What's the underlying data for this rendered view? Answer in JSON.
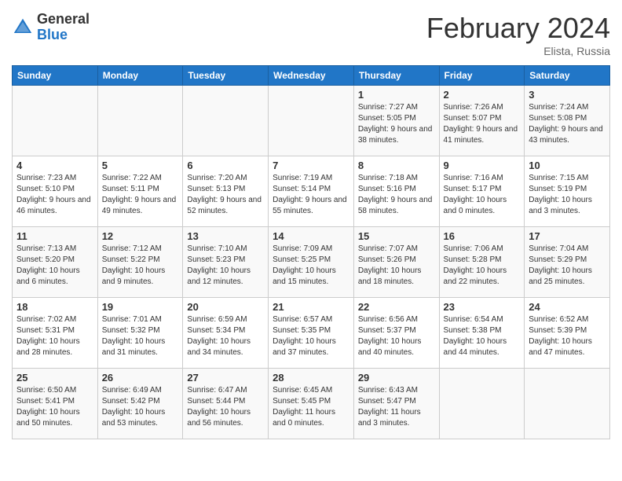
{
  "header": {
    "logo_general": "General",
    "logo_blue": "Blue",
    "month_title": "February 2024",
    "location": "Elista, Russia"
  },
  "days_of_week": [
    "Sunday",
    "Monday",
    "Tuesday",
    "Wednesday",
    "Thursday",
    "Friday",
    "Saturday"
  ],
  "weeks": [
    [
      {
        "day": "",
        "info": ""
      },
      {
        "day": "",
        "info": ""
      },
      {
        "day": "",
        "info": ""
      },
      {
        "day": "",
        "info": ""
      },
      {
        "day": "1",
        "info": "Sunrise: 7:27 AM\nSunset: 5:05 PM\nDaylight: 9 hours and 38 minutes."
      },
      {
        "day": "2",
        "info": "Sunrise: 7:26 AM\nSunset: 5:07 PM\nDaylight: 9 hours and 41 minutes."
      },
      {
        "day": "3",
        "info": "Sunrise: 7:24 AM\nSunset: 5:08 PM\nDaylight: 9 hours and 43 minutes."
      }
    ],
    [
      {
        "day": "4",
        "info": "Sunrise: 7:23 AM\nSunset: 5:10 PM\nDaylight: 9 hours and 46 minutes."
      },
      {
        "day": "5",
        "info": "Sunrise: 7:22 AM\nSunset: 5:11 PM\nDaylight: 9 hours and 49 minutes."
      },
      {
        "day": "6",
        "info": "Sunrise: 7:20 AM\nSunset: 5:13 PM\nDaylight: 9 hours and 52 minutes."
      },
      {
        "day": "7",
        "info": "Sunrise: 7:19 AM\nSunset: 5:14 PM\nDaylight: 9 hours and 55 minutes."
      },
      {
        "day": "8",
        "info": "Sunrise: 7:18 AM\nSunset: 5:16 PM\nDaylight: 9 hours and 58 minutes."
      },
      {
        "day": "9",
        "info": "Sunrise: 7:16 AM\nSunset: 5:17 PM\nDaylight: 10 hours and 0 minutes."
      },
      {
        "day": "10",
        "info": "Sunrise: 7:15 AM\nSunset: 5:19 PM\nDaylight: 10 hours and 3 minutes."
      }
    ],
    [
      {
        "day": "11",
        "info": "Sunrise: 7:13 AM\nSunset: 5:20 PM\nDaylight: 10 hours and 6 minutes."
      },
      {
        "day": "12",
        "info": "Sunrise: 7:12 AM\nSunset: 5:22 PM\nDaylight: 10 hours and 9 minutes."
      },
      {
        "day": "13",
        "info": "Sunrise: 7:10 AM\nSunset: 5:23 PM\nDaylight: 10 hours and 12 minutes."
      },
      {
        "day": "14",
        "info": "Sunrise: 7:09 AM\nSunset: 5:25 PM\nDaylight: 10 hours and 15 minutes."
      },
      {
        "day": "15",
        "info": "Sunrise: 7:07 AM\nSunset: 5:26 PM\nDaylight: 10 hours and 18 minutes."
      },
      {
        "day": "16",
        "info": "Sunrise: 7:06 AM\nSunset: 5:28 PM\nDaylight: 10 hours and 22 minutes."
      },
      {
        "day": "17",
        "info": "Sunrise: 7:04 AM\nSunset: 5:29 PM\nDaylight: 10 hours and 25 minutes."
      }
    ],
    [
      {
        "day": "18",
        "info": "Sunrise: 7:02 AM\nSunset: 5:31 PM\nDaylight: 10 hours and 28 minutes."
      },
      {
        "day": "19",
        "info": "Sunrise: 7:01 AM\nSunset: 5:32 PM\nDaylight: 10 hours and 31 minutes."
      },
      {
        "day": "20",
        "info": "Sunrise: 6:59 AM\nSunset: 5:34 PM\nDaylight: 10 hours and 34 minutes."
      },
      {
        "day": "21",
        "info": "Sunrise: 6:57 AM\nSunset: 5:35 PM\nDaylight: 10 hours and 37 minutes."
      },
      {
        "day": "22",
        "info": "Sunrise: 6:56 AM\nSunset: 5:37 PM\nDaylight: 10 hours and 40 minutes."
      },
      {
        "day": "23",
        "info": "Sunrise: 6:54 AM\nSunset: 5:38 PM\nDaylight: 10 hours and 44 minutes."
      },
      {
        "day": "24",
        "info": "Sunrise: 6:52 AM\nSunset: 5:39 PM\nDaylight: 10 hours and 47 minutes."
      }
    ],
    [
      {
        "day": "25",
        "info": "Sunrise: 6:50 AM\nSunset: 5:41 PM\nDaylight: 10 hours and 50 minutes."
      },
      {
        "day": "26",
        "info": "Sunrise: 6:49 AM\nSunset: 5:42 PM\nDaylight: 10 hours and 53 minutes."
      },
      {
        "day": "27",
        "info": "Sunrise: 6:47 AM\nSunset: 5:44 PM\nDaylight: 10 hours and 56 minutes."
      },
      {
        "day": "28",
        "info": "Sunrise: 6:45 AM\nSunset: 5:45 PM\nDaylight: 11 hours and 0 minutes."
      },
      {
        "day": "29",
        "info": "Sunrise: 6:43 AM\nSunset: 5:47 PM\nDaylight: 11 hours and 3 minutes."
      },
      {
        "day": "",
        "info": ""
      },
      {
        "day": "",
        "info": ""
      }
    ]
  ]
}
